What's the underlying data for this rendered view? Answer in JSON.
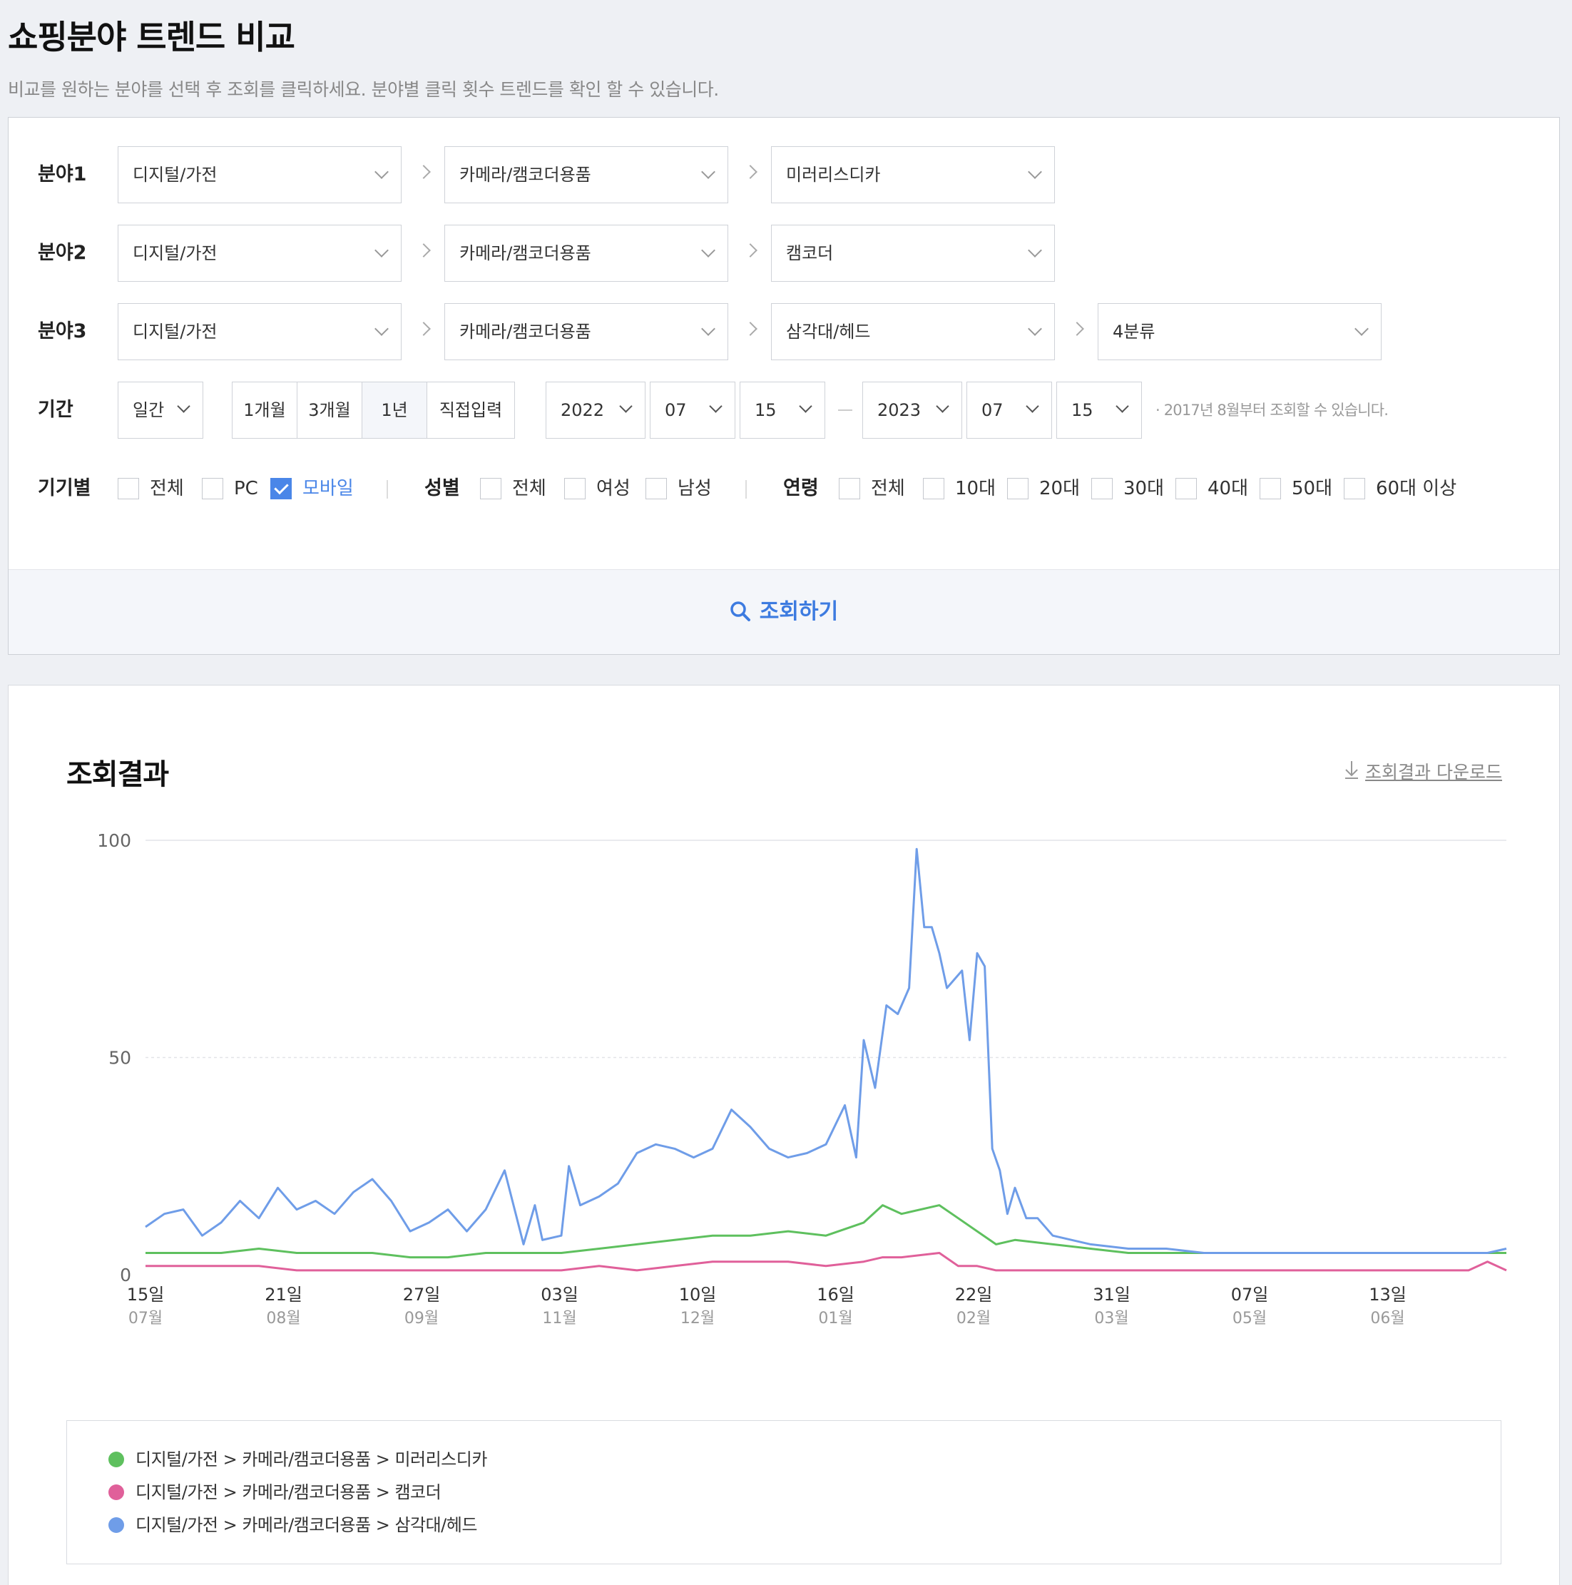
{
  "page": {
    "title": "쇼핑분야 트렌드 비교",
    "description": "비교를 원하는 분야를 선택 후 조회를 클릭하세요. 분야별 클릭 횟수 트렌드를 확인 할 수 있습니다."
  },
  "filters": {
    "fields": [
      {
        "label": "분야1",
        "levels": [
          "디지털/가전",
          "카메라/캠코더용품",
          "미러리스디카"
        ]
      },
      {
        "label": "분야2",
        "levels": [
          "디지털/가전",
          "카메라/캠코더용품",
          "캠코더"
        ]
      },
      {
        "label": "분야3",
        "levels": [
          "디지털/가전",
          "카메라/캠코더용품",
          "삼각대/헤드",
          "4분류"
        ]
      }
    ],
    "period": {
      "label": "기간",
      "unit": "일간",
      "ranges": [
        "1개월",
        "3개월",
        "1년",
        "직접입력"
      ],
      "active_range": "1년",
      "start": {
        "year": "2022",
        "month": "07",
        "day": "15"
      },
      "end": {
        "year": "2023",
        "month": "07",
        "day": "15"
      },
      "note": "· 2017년 8월부터 조회할 수 있습니다."
    },
    "device": {
      "label": "기기별",
      "options": [
        {
          "text": "전체",
          "checked": false
        },
        {
          "text": "PC",
          "checked": false
        },
        {
          "text": "모바일",
          "checked": true
        }
      ]
    },
    "gender": {
      "label": "성별",
      "options": [
        {
          "text": "전체",
          "checked": false
        },
        {
          "text": "여성",
          "checked": false
        },
        {
          "text": "남성",
          "checked": false
        }
      ]
    },
    "age": {
      "label": "연령",
      "options": [
        {
          "text": "전체",
          "checked": false
        },
        {
          "text": "10대",
          "checked": false
        },
        {
          "text": "20대",
          "checked": false
        },
        {
          "text": "30대",
          "checked": false
        },
        {
          "text": "40대",
          "checked": false
        },
        {
          "text": "50대",
          "checked": false
        },
        {
          "text": "60대 이상",
          "checked": false
        }
      ]
    },
    "search_label": "조회하기"
  },
  "result": {
    "title": "조회결과",
    "download_label": "조회결과 다운로드"
  },
  "chart_data": {
    "type": "line",
    "ylim": [
      0,
      100
    ],
    "y_ticks": [
      0,
      50,
      100
    ],
    "x_ticks": [
      {
        "day": "15일",
        "month": "07월"
      },
      {
        "day": "21일",
        "month": "08월"
      },
      {
        "day": "27일",
        "month": "09월"
      },
      {
        "day": "03일",
        "month": "11월"
      },
      {
        "day": "10일",
        "month": "12월"
      },
      {
        "day": "16일",
        "month": "01월"
      },
      {
        "day": "22일",
        "month": "02월"
      },
      {
        "day": "31일",
        "month": "03월"
      },
      {
        "day": "07일",
        "month": "05월"
      },
      {
        "day": "13일",
        "month": "06월"
      }
    ],
    "series": [
      {
        "name": "디지털/가전 > 카메라/캠코더용품 > 미러리스디카",
        "color": "#5ec05e",
        "points": [
          [
            0,
            5
          ],
          [
            10,
            5
          ],
          [
            20,
            5
          ],
          [
            30,
            6
          ],
          [
            40,
            5
          ],
          [
            50,
            5
          ],
          [
            60,
            5
          ],
          [
            70,
            4
          ],
          [
            80,
            4
          ],
          [
            90,
            5
          ],
          [
            100,
            5
          ],
          [
            110,
            5
          ],
          [
            120,
            6
          ],
          [
            130,
            7
          ],
          [
            140,
            8
          ],
          [
            150,
            9
          ],
          [
            160,
            9
          ],
          [
            170,
            10
          ],
          [
            180,
            9
          ],
          [
            190,
            12
          ],
          [
            195,
            16
          ],
          [
            200,
            14
          ],
          [
            210,
            16
          ],
          [
            215,
            13
          ],
          [
            220,
            10
          ],
          [
            225,
            7
          ],
          [
            230,
            8
          ],
          [
            240,
            7
          ],
          [
            250,
            6
          ],
          [
            260,
            5
          ],
          [
            270,
            5
          ],
          [
            280,
            5
          ],
          [
            290,
            5
          ],
          [
            300,
            5
          ],
          [
            310,
            5
          ],
          [
            320,
            5
          ],
          [
            330,
            5
          ],
          [
            340,
            5
          ],
          [
            350,
            5
          ],
          [
            360,
            5
          ]
        ]
      },
      {
        "name": "디지털/가전 > 카메라/캠코더용품 > 캠코더",
        "color": "#e0609a",
        "points": [
          [
            0,
            2
          ],
          [
            10,
            2
          ],
          [
            20,
            2
          ],
          [
            30,
            2
          ],
          [
            40,
            1
          ],
          [
            50,
            1
          ],
          [
            60,
            1
          ],
          [
            70,
            1
          ],
          [
            80,
            1
          ],
          [
            90,
            1
          ],
          [
            100,
            1
          ],
          [
            110,
            1
          ],
          [
            120,
            2
          ],
          [
            130,
            1
          ],
          [
            140,
            2
          ],
          [
            150,
            3
          ],
          [
            160,
            3
          ],
          [
            170,
            3
          ],
          [
            180,
            2
          ],
          [
            190,
            3
          ],
          [
            195,
            4
          ],
          [
            200,
            4
          ],
          [
            210,
            5
          ],
          [
            215,
            2
          ],
          [
            220,
            2
          ],
          [
            225,
            1
          ],
          [
            230,
            1
          ],
          [
            240,
            1
          ],
          [
            250,
            1
          ],
          [
            260,
            1
          ],
          [
            270,
            1
          ],
          [
            280,
            1
          ],
          [
            290,
            1
          ],
          [
            300,
            1
          ],
          [
            310,
            1
          ],
          [
            320,
            1
          ],
          [
            330,
            1
          ],
          [
            340,
            1
          ],
          [
            350,
            1
          ],
          [
            355,
            3
          ],
          [
            360,
            1
          ]
        ]
      },
      {
        "name": "디지털/가전 > 카메라/캠코더용품 > 삼각대/헤드",
        "color": "#6f9de8",
        "points": [
          [
            0,
            11
          ],
          [
            5,
            14
          ],
          [
            10,
            15
          ],
          [
            15,
            9
          ],
          [
            20,
            12
          ],
          [
            25,
            17
          ],
          [
            30,
            13
          ],
          [
            35,
            20
          ],
          [
            40,
            15
          ],
          [
            45,
            17
          ],
          [
            50,
            14
          ],
          [
            55,
            19
          ],
          [
            60,
            22
          ],
          [
            65,
            17
          ],
          [
            70,
            10
          ],
          [
            75,
            12
          ],
          [
            80,
            15
          ],
          [
            85,
            10
          ],
          [
            90,
            15
          ],
          [
            95,
            24
          ],
          [
            100,
            7
          ],
          [
            103,
            16
          ],
          [
            105,
            8
          ],
          [
            110,
            9
          ],
          [
            112,
            25
          ],
          [
            115,
            16
          ],
          [
            120,
            18
          ],
          [
            125,
            21
          ],
          [
            130,
            28
          ],
          [
            135,
            30
          ],
          [
            140,
            29
          ],
          [
            145,
            27
          ],
          [
            150,
            29
          ],
          [
            155,
            38
          ],
          [
            160,
            34
          ],
          [
            165,
            29
          ],
          [
            170,
            27
          ],
          [
            175,
            28
          ],
          [
            180,
            30
          ],
          [
            185,
            39
          ],
          [
            188,
            27
          ],
          [
            190,
            54
          ],
          [
            193,
            43
          ],
          [
            196,
            62
          ],
          [
            199,
            60
          ],
          [
            202,
            66
          ],
          [
            204,
            98
          ],
          [
            206,
            80
          ],
          [
            208,
            80
          ],
          [
            210,
            74
          ],
          [
            212,
            66
          ],
          [
            214,
            68
          ],
          [
            216,
            70
          ],
          [
            218,
            54
          ],
          [
            220,
            74
          ],
          [
            222,
            71
          ],
          [
            224,
            29
          ],
          [
            226,
            24
          ],
          [
            228,
            14
          ],
          [
            230,
            20
          ],
          [
            233,
            13
          ],
          [
            236,
            13
          ],
          [
            240,
            9
          ],
          [
            245,
            8
          ],
          [
            250,
            7
          ],
          [
            260,
            6
          ],
          [
            270,
            6
          ],
          [
            280,
            5
          ],
          [
            290,
            5
          ],
          [
            300,
            5
          ],
          [
            310,
            5
          ],
          [
            320,
            5
          ],
          [
            330,
            5
          ],
          [
            340,
            5
          ],
          [
            350,
            5
          ],
          [
            355,
            5
          ],
          [
            360,
            6
          ]
        ]
      }
    ]
  }
}
